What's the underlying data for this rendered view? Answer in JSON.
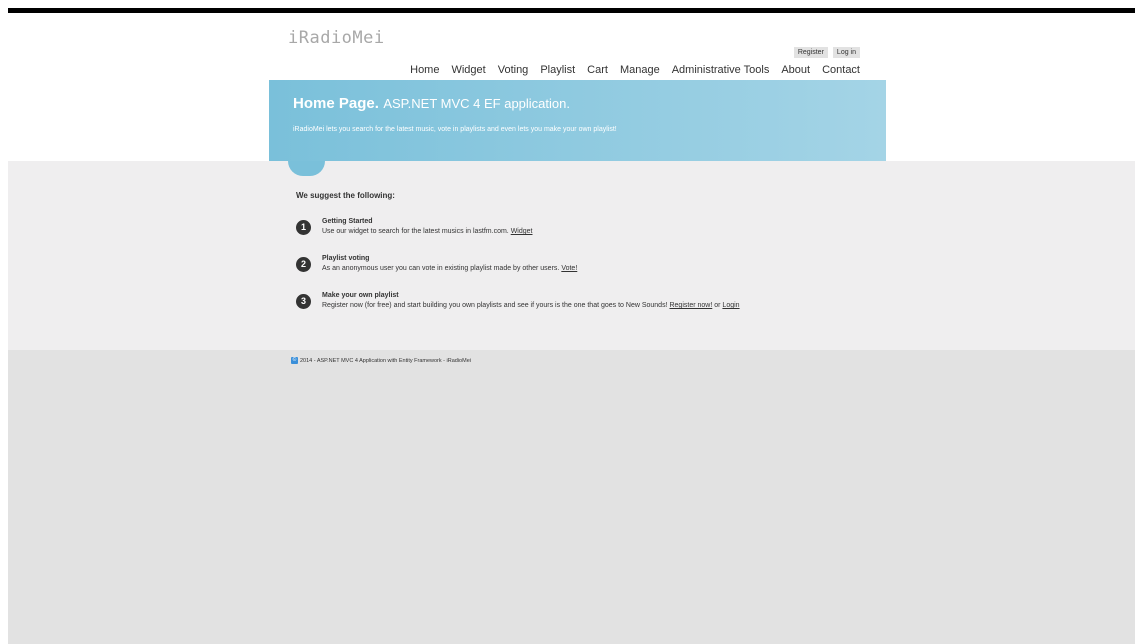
{
  "header": {
    "site_title": "iRadioMei",
    "register_label": "Register",
    "login_label": "Log in",
    "nav": [
      "Home",
      "Widget",
      "Voting",
      "Playlist",
      "Cart",
      "Manage",
      "Administrative Tools",
      "About",
      "Contact"
    ]
  },
  "featured": {
    "title_strong": "Home Page.",
    "title_sub": "ASP.NET MVC 4 EF application.",
    "text": "iRadioMei lets you search for the latest music, vote in playlists and even lets you make your own playlist!"
  },
  "main": {
    "suggest_title": "We suggest the following:",
    "steps": [
      {
        "num": "1",
        "title": "Getting Started",
        "text": "Use our widget to search for the latest musics in lastfm.com.",
        "link1": "Widget",
        "sep": "",
        "link2": ""
      },
      {
        "num": "2",
        "title": "Playlist voting",
        "text": "As an anonymous user you can vote in existing playlist made by other users.",
        "link1": "Vote!",
        "sep": "",
        "link2": ""
      },
      {
        "num": "3",
        "title": "Make your own playlist",
        "text": "Register now (for free) and start building you own playlists and see if yours is the one that goes to New Sounds!",
        "link1": "Register now!",
        "sep": "or",
        "link2": "Login"
      }
    ]
  },
  "footer": {
    "copyright_symbol": "©",
    "text": "2014 - ASP.NET MVC 4 Application with Entity Framework - iRadioMei"
  }
}
